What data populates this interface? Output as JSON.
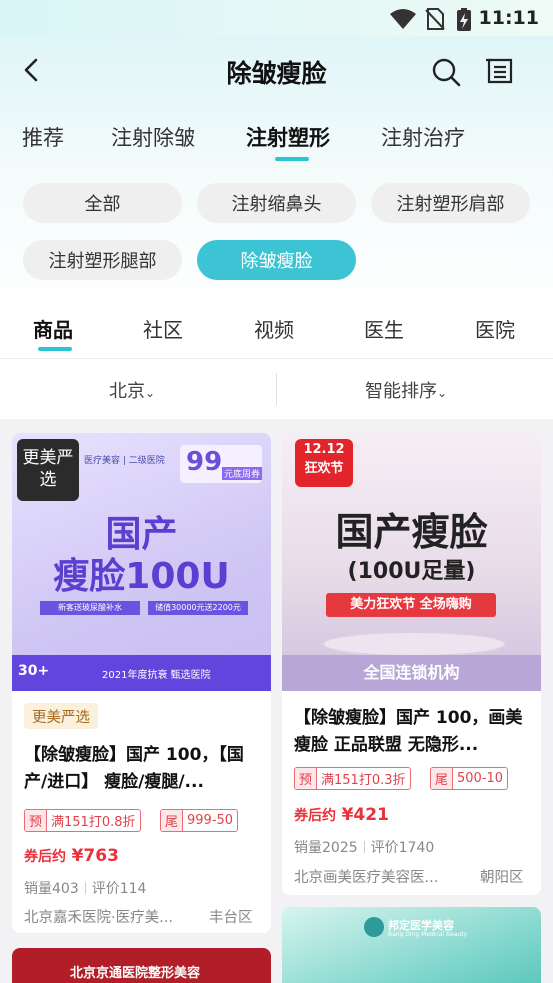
{
  "status_bar": {
    "time": "11:11"
  },
  "header": {
    "title": "除皱瘦脸"
  },
  "category_tabs": [
    {
      "label": "推荐",
      "active": false
    },
    {
      "label": "注射除皱",
      "active": false
    },
    {
      "label": "注射塑形",
      "active": true
    },
    {
      "label": "注射治疗",
      "active": false
    }
  ],
  "chips": [
    {
      "label": "全部",
      "active": false
    },
    {
      "label": "注射缩鼻头",
      "active": false
    },
    {
      "label": "注射塑形肩部",
      "active": false
    },
    {
      "label": "注射塑形腿部",
      "active": false
    },
    {
      "label": "除皱瘦脸",
      "active": true
    }
  ],
  "main_tabs": [
    {
      "label": "商品",
      "active": true
    },
    {
      "label": "社区",
      "active": false
    },
    {
      "label": "视频",
      "active": false
    },
    {
      "label": "医生",
      "active": false
    },
    {
      "label": "医院",
      "active": false
    }
  ],
  "filters": {
    "city": "北京",
    "sort": "智能排序"
  },
  "products": [
    {
      "image": {
        "badge": "更美严选",
        "hospital": "医疗美容 | 二级医院",
        "headline_1": "国产",
        "headline_2": "瘦脸100U",
        "price_tag": "99",
        "price_note": "元底周券",
        "bar_1": "新客送玻尿酸补水",
        "bar_2": "储值30000元送2200元",
        "footer": "2021年度抗衰 甄选医院",
        "corner": "30+"
      },
      "badge": "更美严选",
      "title": "【除皱瘦脸】国产 100，【国产/进口】 瘦脸/瘦腿/...",
      "tags": [
        {
          "k": "预",
          "v": "满151打0.8折"
        },
        {
          "k": "尾",
          "v": "999-50"
        }
      ],
      "price_label": "券后约",
      "price": "¥763",
      "sales": "销量403",
      "reviews": "评价114",
      "hospital": "北京嘉禾医院·医疗美...",
      "district": "丰台区"
    },
    {
      "image": {
        "badge_top": "12.12",
        "badge_bottom": "狂欢节",
        "headline_1": "国产瘦脸",
        "headline_2": "(100U足量)",
        "ribbon": "美力狂欢节 全场嗨购",
        "footer": "全国连锁机构"
      },
      "title": "【除皱瘦脸】国产 100，画美瘦脸 正品联盟 无隐形...",
      "tags": [
        {
          "k": "预",
          "v": "满151打0.3折"
        },
        {
          "k": "尾",
          "v": "500-10"
        }
      ],
      "price_label": "券后约",
      "price": "¥421",
      "sales": "销量2025",
      "reviews": "评价1740",
      "hospital": "北京画美医疗美容医...",
      "district": "朝阳区"
    },
    {
      "image": {
        "text": "北京京通医院整形美容"
      }
    },
    {
      "image": {
        "text": "邦定医学美容",
        "sub": "Bang Ding Medical Beauty"
      }
    }
  ],
  "colors": {
    "accent": "#2cc3d3",
    "price": "#e8333c"
  }
}
